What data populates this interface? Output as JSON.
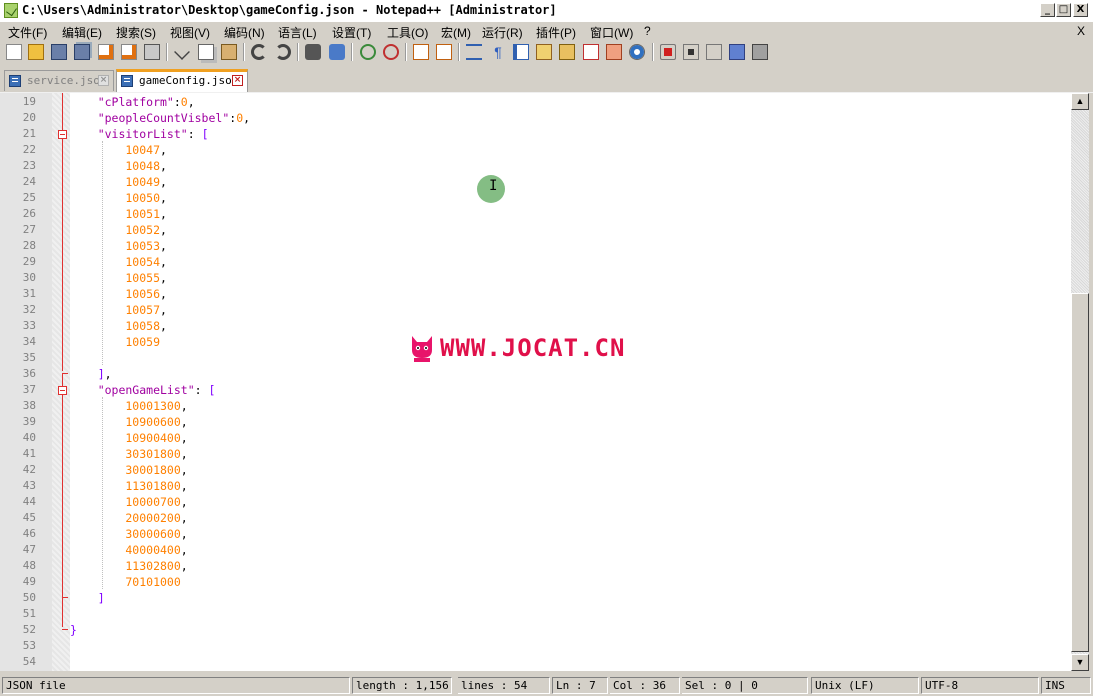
{
  "window": {
    "title": "C:\\Users\\Administrator\\Desktop\\gameConfig.json - Notepad++ [Administrator]",
    "minimize": "_",
    "maximize": "□",
    "close": "X"
  },
  "menu": {
    "items": [
      "文件(F)",
      "编辑(E)",
      "搜索(S)",
      "视图(V)",
      "编码(N)",
      "语言(L)",
      "设置(T)",
      "工具(O)",
      "宏(M)",
      "运行(R)",
      "插件(P)",
      "窗口(W)",
      "?"
    ],
    "close_doc": "X"
  },
  "toolbar": {
    "icons": [
      "new-file-icon",
      "open-file-icon",
      "save-icon",
      "save-all-icon",
      "close-icon",
      "close-all-icon",
      "print-icon",
      "cut-icon",
      "copy-icon",
      "paste-icon",
      "undo-icon",
      "redo-icon",
      "find-icon",
      "replace-icon",
      "zoom-in-icon",
      "zoom-out-icon",
      "sync-vertical-icon",
      "sync-horizontal-icon",
      "word-wrap-icon",
      "show-all-chars-icon",
      "indent-guide-icon",
      "user-lang-icon",
      "doc-map-icon",
      "function-list-icon",
      "folder-workspace-icon",
      "monitor-icon",
      "record-macro-icon",
      "stop-macro-icon",
      "play-macro-icon",
      "run-macro-multiple-icon",
      "save-macro-icon"
    ]
  },
  "tabs": [
    {
      "label": "service.json",
      "active": false
    },
    {
      "label": "gameConfig.json",
      "active": true
    }
  ],
  "editor": {
    "lines": [
      {
        "n": "19",
        "tokens": [
          [
            "k",
            "    \"cPlatform\""
          ],
          [
            "p",
            ":"
          ],
          [
            "num",
            "0"
          ],
          [
            "p",
            ","
          ]
        ]
      },
      {
        "n": "20",
        "tokens": [
          [
            "k",
            "    \"peopleCountVisbel\""
          ],
          [
            "p",
            ":"
          ],
          [
            "num",
            "0"
          ],
          [
            "p",
            ","
          ]
        ]
      },
      {
        "n": "21",
        "tokens": [
          [
            "k",
            "    \"visitorList\""
          ],
          [
            "p",
            ": "
          ],
          [
            "b",
            "["
          ]
        ]
      },
      {
        "n": "22",
        "tokens": [
          [
            "num",
            "        10047"
          ],
          [
            "p",
            ","
          ]
        ]
      },
      {
        "n": "23",
        "tokens": [
          [
            "num",
            "        10048"
          ],
          [
            "p",
            ","
          ]
        ]
      },
      {
        "n": "24",
        "tokens": [
          [
            "num",
            "        10049"
          ],
          [
            "p",
            ","
          ]
        ]
      },
      {
        "n": "25",
        "tokens": [
          [
            "num",
            "        10050"
          ],
          [
            "p",
            ","
          ]
        ]
      },
      {
        "n": "26",
        "tokens": [
          [
            "num",
            "        10051"
          ],
          [
            "p",
            ","
          ]
        ]
      },
      {
        "n": "27",
        "tokens": [
          [
            "num",
            "        10052"
          ],
          [
            "p",
            ","
          ]
        ]
      },
      {
        "n": "28",
        "tokens": [
          [
            "num",
            "        10053"
          ],
          [
            "p",
            ","
          ]
        ]
      },
      {
        "n": "29",
        "tokens": [
          [
            "num",
            "        10054"
          ],
          [
            "p",
            ","
          ]
        ]
      },
      {
        "n": "30",
        "tokens": [
          [
            "num",
            "        10055"
          ],
          [
            "p",
            ","
          ]
        ]
      },
      {
        "n": "31",
        "tokens": [
          [
            "num",
            "        10056"
          ],
          [
            "p",
            ","
          ]
        ]
      },
      {
        "n": "32",
        "tokens": [
          [
            "num",
            "        10057"
          ],
          [
            "p",
            ","
          ]
        ]
      },
      {
        "n": "33",
        "tokens": [
          [
            "num",
            "        10058"
          ],
          [
            "p",
            ","
          ]
        ]
      },
      {
        "n": "34",
        "tokens": [
          [
            "num",
            "        10059"
          ]
        ]
      },
      {
        "n": "35",
        "tokens": []
      },
      {
        "n": "36",
        "tokens": [
          [
            "b",
            "    ]"
          ],
          [
            "p",
            ","
          ]
        ]
      },
      {
        "n": "37",
        "tokens": [
          [
            "k",
            "    \"openGameList\""
          ],
          [
            "p",
            ": "
          ],
          [
            "b",
            "["
          ]
        ]
      },
      {
        "n": "38",
        "tokens": [
          [
            "num",
            "        10001300"
          ],
          [
            "p",
            ","
          ]
        ]
      },
      {
        "n": "39",
        "tokens": [
          [
            "num",
            "        10900600"
          ],
          [
            "p",
            ","
          ]
        ]
      },
      {
        "n": "40",
        "tokens": [
          [
            "num",
            "        10900400"
          ],
          [
            "p",
            ","
          ]
        ]
      },
      {
        "n": "41",
        "tokens": [
          [
            "num",
            "        30301800"
          ],
          [
            "p",
            ","
          ]
        ]
      },
      {
        "n": "42",
        "tokens": [
          [
            "num",
            "        30001800"
          ],
          [
            "p",
            ","
          ]
        ]
      },
      {
        "n": "43",
        "tokens": [
          [
            "num",
            "        11301800"
          ],
          [
            "p",
            ","
          ]
        ]
      },
      {
        "n": "44",
        "tokens": [
          [
            "num",
            "        10000700"
          ],
          [
            "p",
            ","
          ]
        ]
      },
      {
        "n": "45",
        "tokens": [
          [
            "num",
            "        20000200"
          ],
          [
            "p",
            ","
          ]
        ]
      },
      {
        "n": "46",
        "tokens": [
          [
            "num",
            "        30000600"
          ],
          [
            "p",
            ","
          ]
        ]
      },
      {
        "n": "47",
        "tokens": [
          [
            "num",
            "        40000400"
          ],
          [
            "p",
            ","
          ]
        ]
      },
      {
        "n": "48",
        "tokens": [
          [
            "num",
            "        11302800"
          ],
          [
            "p",
            ","
          ]
        ]
      },
      {
        "n": "49",
        "tokens": [
          [
            "num",
            "        70101000"
          ]
        ]
      },
      {
        "n": "50",
        "tokens": [
          [
            "b",
            "    ]"
          ]
        ]
      },
      {
        "n": "51",
        "tokens": []
      },
      {
        "n": "52",
        "tokens": [
          [
            "b",
            "}"
          ]
        ]
      },
      {
        "n": "53",
        "tokens": []
      },
      {
        "n": "54",
        "tokens": []
      }
    ],
    "cursor_glyph": "I",
    "watermark": "WWW.JOCAT.CN"
  },
  "scrollbar": {
    "up": "▲",
    "down": "▼"
  },
  "status": {
    "file_type": "JSON file",
    "length": "length : 1,156",
    "lines": "lines : 54",
    "ln": "Ln : 7",
    "col": "Col : 36",
    "sel": "Sel : 0 | 0",
    "eol": "Unix (LF)",
    "encoding": "UTF-8",
    "mode": "INS"
  }
}
